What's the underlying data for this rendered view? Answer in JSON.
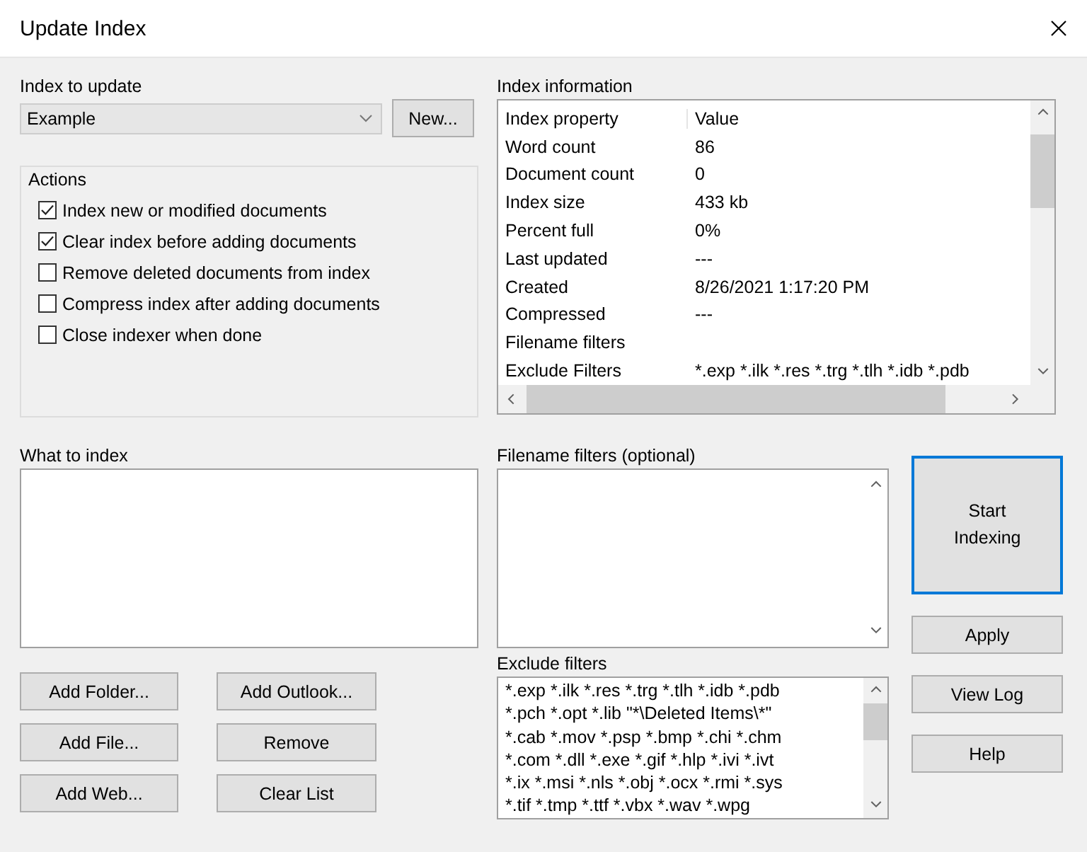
{
  "window": {
    "title": "Update Index"
  },
  "index_to_update": {
    "label": "Index to update",
    "value": "Example",
    "new_button": "New..."
  },
  "actions": {
    "title": "Actions",
    "items": [
      {
        "label": "Index new or modified documents",
        "checked": true
      },
      {
        "label": "Clear index before adding documents",
        "checked": true
      },
      {
        "label": "Remove deleted documents from index",
        "checked": false
      },
      {
        "label": "Compress index after adding documents",
        "checked": false
      },
      {
        "label": "Close indexer when done",
        "checked": false
      }
    ]
  },
  "index_information": {
    "label": "Index information",
    "columns": [
      "Index property",
      "Value"
    ],
    "rows": [
      {
        "property": "Word count",
        "value": "86"
      },
      {
        "property": "Document count",
        "value": "0"
      },
      {
        "property": "Index size",
        "value": "433 kb"
      },
      {
        "property": "Percent full",
        "value": "0%"
      },
      {
        "property": "Last updated",
        "value": "---"
      },
      {
        "property": "Created",
        "value": "8/26/2021 1:17:20 PM"
      },
      {
        "property": "Compressed",
        "value": "---"
      },
      {
        "property": "Filename filters"
      },
      {
        "property": "Exclude Filters",
        "value": "*.exp *.ilk *.res *.trg *.tlh *.idb *.pdb"
      }
    ]
  },
  "what_to_index": {
    "label": "What to index",
    "buttons": [
      [
        "Add Folder...",
        "Add Outlook..."
      ],
      [
        "Add File...",
        "Remove"
      ],
      [
        "Add Web...",
        "Clear List"
      ]
    ]
  },
  "filename_filters": {
    "label": "Filename filters (optional)"
  },
  "exclude_filters": {
    "label": "Exclude filters",
    "lines": [
      "*.exp *.ilk *.res *.trg *.tlh *.idb *.pdb",
      "*.pch *.opt *.lib \"*\\Deleted Items\\*\"",
      "*.cab *.mov *.psp *.bmp *.chi *.chm",
      "*.com *.dll *.exe *.gif *.hlp *.ivi *.ivt",
      "*.ix *.msi *.nls *.obj *.ocx *.rmi *.sys",
      "*.tif *.tmp *.ttf *.vbx *.wav *.wpg"
    ]
  },
  "side_buttons": {
    "primary": "Start Indexing",
    "others": [
      "Apply",
      "View Log",
      "Help"
    ]
  }
}
